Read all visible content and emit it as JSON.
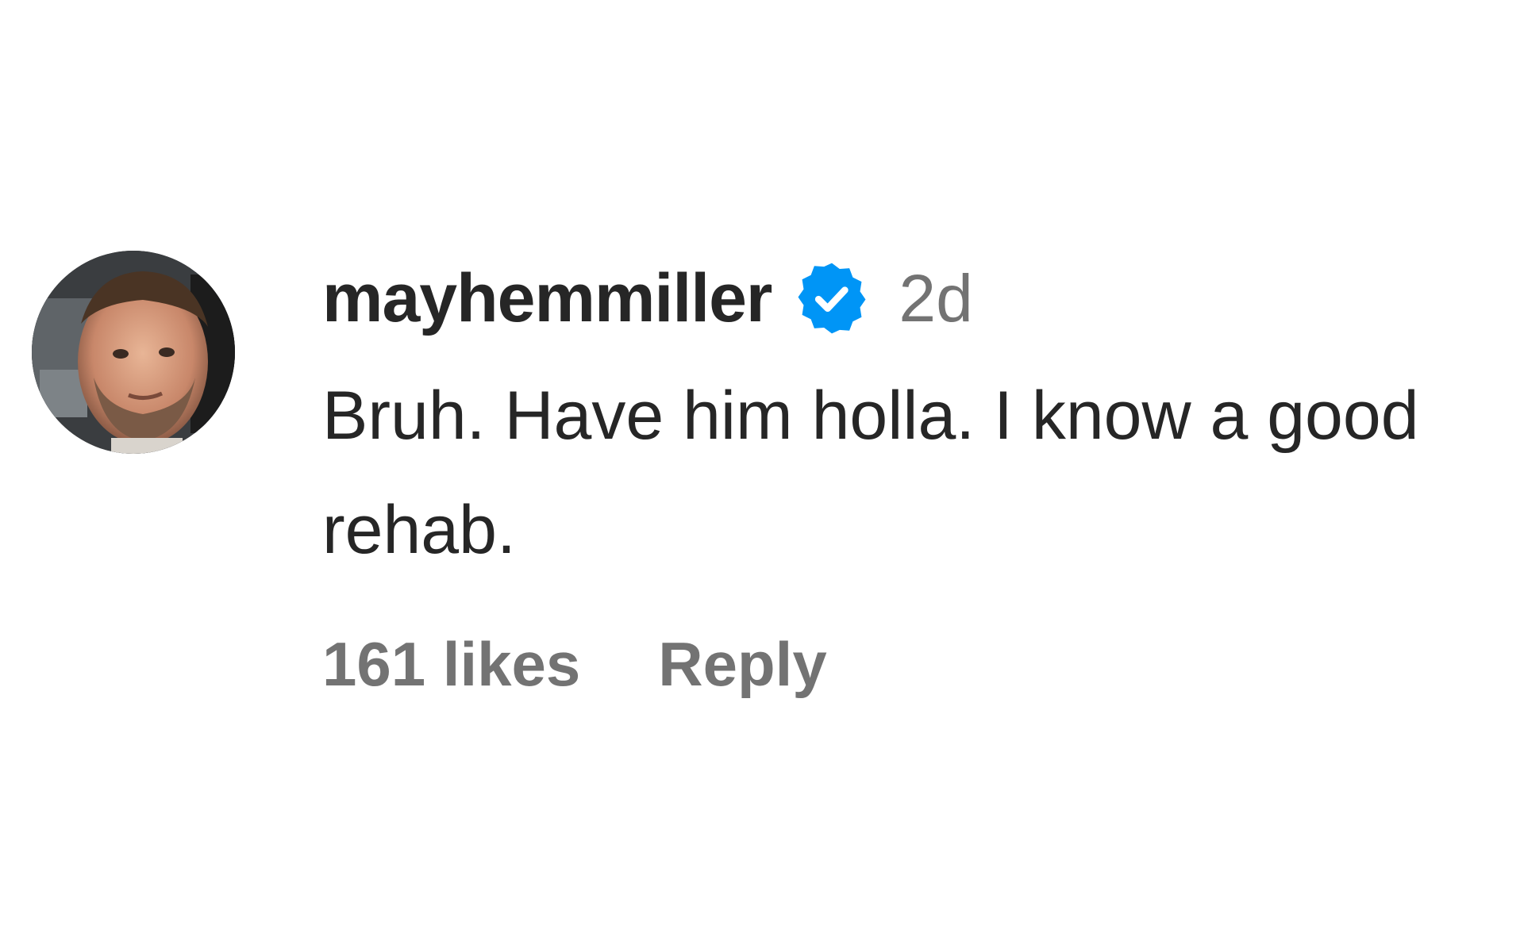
{
  "comment": {
    "username": "mayhemmiller",
    "verified": true,
    "timestamp": "2d",
    "text": "Bruh. Have him holla. I know a good rehab.",
    "likes_label": "161 likes",
    "reply_label": "Reply"
  },
  "colors": {
    "primary_text": "#262626",
    "secondary_text": "#737373",
    "verified_badge": "#0095f6",
    "background": "#ffffff"
  },
  "icons": {
    "avatar": "profile-photo",
    "verified": "verified-badge-icon"
  }
}
